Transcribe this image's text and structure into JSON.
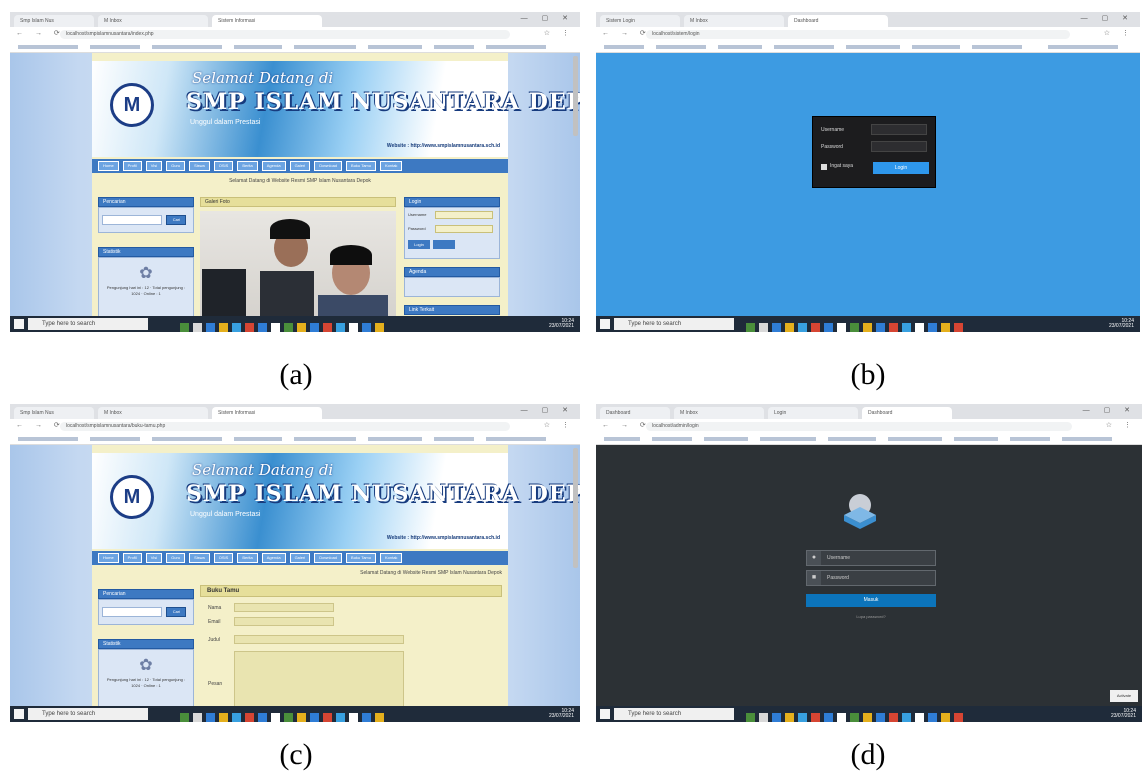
{
  "captions": [
    "(a)",
    "(b)",
    "(c)",
    "(d)"
  ],
  "browser": {
    "tabs_a": [
      "Smp Islam Nus",
      "M Inbox",
      "Sistem Informasi"
    ],
    "tabs_b": [
      "Sistem Login",
      "M Inbox",
      "Dashboard"
    ],
    "tabs_c": [
      "Smp Islam Nus",
      "M Inbox",
      "Sistem Informasi"
    ],
    "tabs_d": [
      "Dashboard",
      "M Inbox",
      "Login",
      "Dashboard"
    ],
    "url_a": "localhost/smpislamnusantara/index.php",
    "url_b": "localhost/sistem/login",
    "url_c": "localhost/smpislamnusantara/buku-tamu.php",
    "url_d": "localhost/admin/login"
  },
  "site": {
    "tagline": "Selamat Datang di",
    "school_name_a": "SMP ISLAM NUSANTARA DEPOK",
    "school_name_c": "SMP ISLAM NUSANTARA DEPOK",
    "sub": "Unggul dalam Prestasi",
    "web": "Website : http://www.smpislamnusantara.sch.id",
    "nav": [
      "Home",
      "Profil",
      "Visi",
      "Guru",
      "Siswa",
      "OSIS",
      "Berita",
      "Agenda",
      "Galeri",
      "Download",
      "Buku Tamu",
      "Kontak"
    ],
    "marquee": "Selamat Datang di Website Resmi SMP Islam Nusantara Depok",
    "search_title": "Pencarian",
    "search_button": "Cari",
    "stats_title": "Statistik",
    "stats_text": "Pengunjung hari ini : 12 · Total pengunjung : 1024 · Online : 1",
    "gallery_title": "Galeri Foto",
    "login_title": "Login",
    "login_user": "Username",
    "login_pass": "Password",
    "login_btn": "Login",
    "agenda_title": "Agenda",
    "link_title": "Link Terkait",
    "guestbook_title": "Buku Tamu",
    "form_labels": [
      "Nama",
      "Email",
      "Judul",
      "Pesan"
    ]
  },
  "login_b": {
    "username_label": "Username",
    "password_label": "Password",
    "remember_label": "Ingat saya",
    "login_button": "Login"
  },
  "login_d": {
    "username": "Username",
    "password": "Password",
    "login_button": "Masuk",
    "footer": "Lupa password?",
    "toast": "Activate"
  },
  "taskbar": {
    "search": "Type here to search",
    "time": "10:24",
    "date": "23/07/2021"
  }
}
